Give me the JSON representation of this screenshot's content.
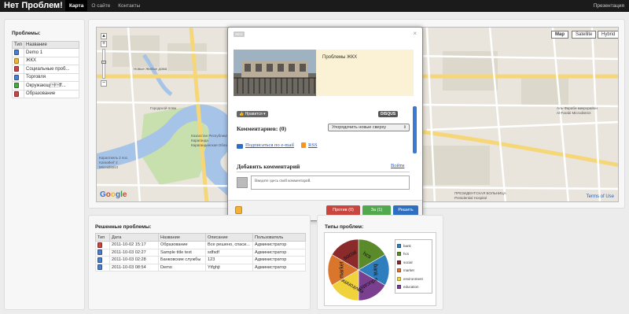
{
  "app": {
    "title": "Нет Проблем!"
  },
  "nav": {
    "items": [
      {
        "label": "Карта",
        "active": true
      },
      {
        "label": "О сайте",
        "active": false
      },
      {
        "label": "Контакты",
        "active": false
      }
    ],
    "right_link": "Презентация"
  },
  "sidebar": {
    "title": "Проблемы:",
    "columns": [
      "Тип",
      "Название"
    ],
    "rows": [
      {
        "icon": "blue-pin-icon",
        "color": "#4a7fd0",
        "name": "Demo 1"
      },
      {
        "icon": "yellow-pin-icon",
        "color": "#f0b630",
        "name": "ЖКХ"
      },
      {
        "icon": "red-pin-icon",
        "color": "#c94444",
        "name": "Социальные проб..."
      },
      {
        "icon": "blue-pin-icon",
        "color": "#4a7fd0",
        "name": "Торговля"
      },
      {
        "icon": "green-pin-icon",
        "color": "#49a842",
        "name": "Окружающ\u0002\u0003ff..."
      },
      {
        "icon": "red-pin-icon",
        "color": "#c94444",
        "name": "Образование"
      }
    ]
  },
  "map": {
    "types": [
      "Map",
      "Satellite",
      "Hybrid"
    ],
    "selected_type": "Map",
    "terms": "Terms of Use",
    "google": "Google",
    "labels": [
      "Городской пляж",
      "Казахстан Республикасы",
      "Караганда",
      "Карагандинская Областная",
      "Аль-Фараби микрорайон",
      "Al-Farabi Microdistrict",
      "ПРЕЗИДЕНТСКАЯ БОЛЬНИЦА",
      "Presidential Hospital",
      "Караоткель 2 пос.",
      "Karaotkel' 2",
      "Microdistrict",
      "Новые Жилые дома"
    ]
  },
  "popup": {
    "badge": "ЖКХ",
    "close": "×",
    "title": "Проблемы ЖКХ",
    "like": "Нравится",
    "disqus": "DISQUS",
    "comments_count": "Комментариев: (0)",
    "sort": "Упорядочить новые сверху",
    "subscribe": "Подписаться по e-mail",
    "rss": "RSS",
    "add_comment": "Добавить комментарий",
    "login": "Войти",
    "comment_placeholder": "Введите здесь свой комментарий.",
    "buttons": {
      "against": "Против (0)",
      "for": "За (1)",
      "solve": "Решить"
    },
    "button_colors": {
      "against": "#c9463e",
      "for": "#52a84c",
      "solve": "#2e6fc0"
    }
  },
  "solved": {
    "title": "Решенные проблемы:",
    "columns": [
      "Тип",
      "Дата",
      "Название",
      "Описание",
      "Пользователь"
    ],
    "rows": [
      {
        "icon": "red-pin-icon",
        "color": "#c94444",
        "date": "2011-10-02 15:17",
        "name": "Образование",
        "desc": "Все решено, спаси...",
        "user": "Администратор"
      },
      {
        "icon": "blue-pin-icon",
        "color": "#4a7fd0",
        "date": "2011-10-03 02:27",
        "name": "Sample title text",
        "desc": "sdfsdf",
        "user": "Администратор"
      },
      {
        "icon": "blue-pin-icon",
        "color": "#4a7fd0",
        "date": "2011-10-03 02:28",
        "name": "Банковские службы",
        "desc": "123",
        "user": "Администратор"
      },
      {
        "icon": "blue-pin-icon",
        "color": "#4a7fd0",
        "date": "2011-10-03 08:54",
        "name": "Demo",
        "desc": "Ytfghjt",
        "user": "Администратор"
      }
    ]
  },
  "types": {
    "title": "Типы проблем:"
  },
  "chart_data": {
    "type": "pie",
    "title": "",
    "categories": [
      "bank",
      "hcs",
      "social",
      "market",
      "environment",
      "education"
    ],
    "values": [
      1,
      1,
      1,
      1,
      1,
      1
    ],
    "colors": [
      "#2f7ebd",
      "#5b8a2b",
      "#8a2a2a",
      "#d9762b",
      "#f0d23a",
      "#7a3f8f"
    ],
    "slice_labels": [
      "bank",
      "hcs",
      "social",
      "market",
      "environment",
      "education"
    ],
    "legend_position": "right"
  }
}
